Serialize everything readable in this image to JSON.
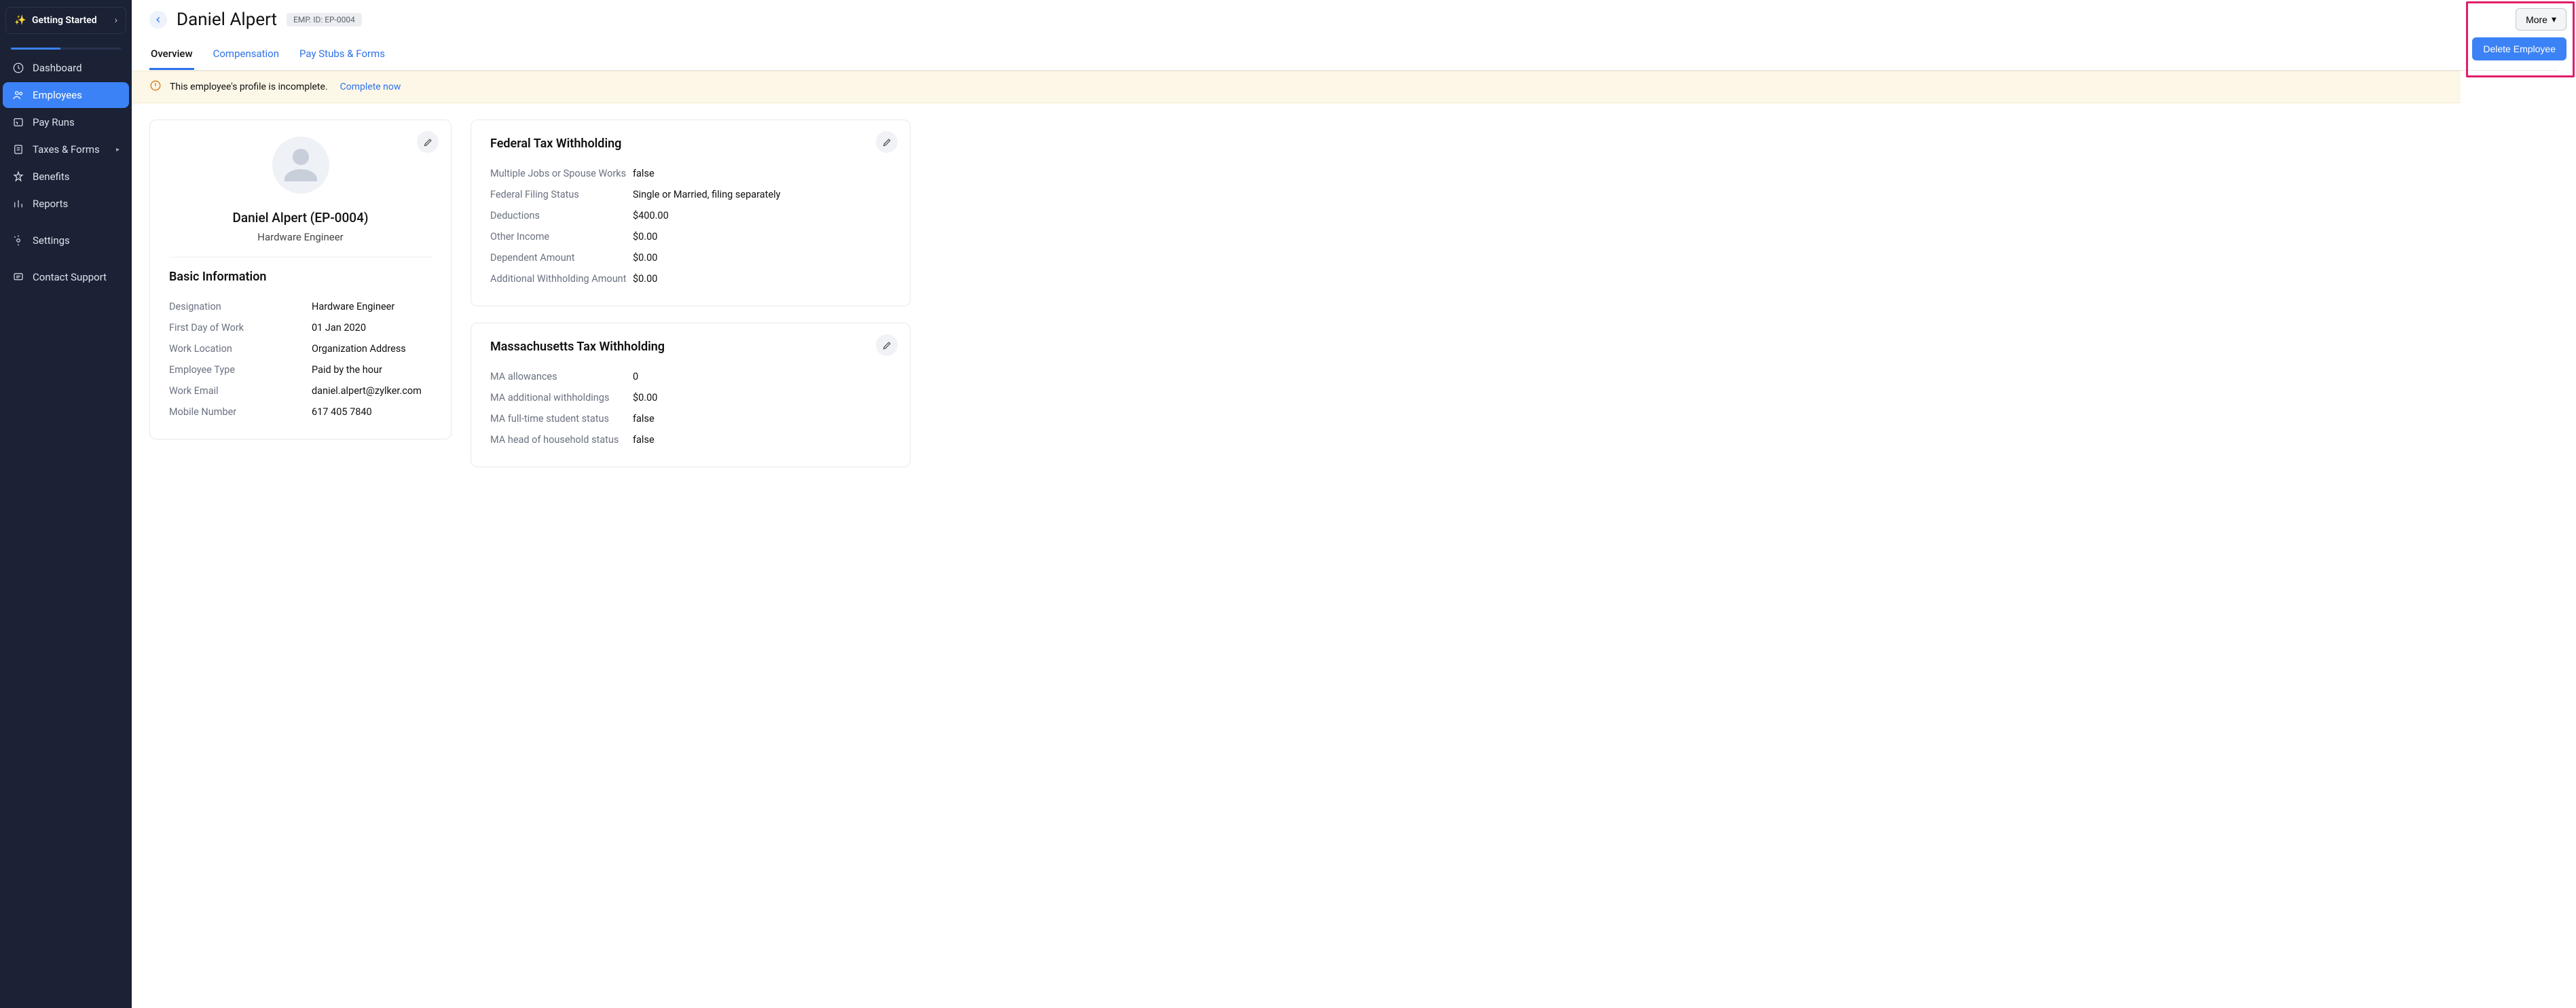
{
  "sidebar": {
    "getting_started": "Getting Started",
    "items": [
      {
        "label": "Dashboard"
      },
      {
        "label": "Employees"
      },
      {
        "label": "Pay Runs"
      },
      {
        "label": "Taxes & Forms"
      },
      {
        "label": "Benefits"
      },
      {
        "label": "Reports"
      },
      {
        "label": "Settings"
      },
      {
        "label": "Contact Support"
      }
    ]
  },
  "header": {
    "employee_name": "Daniel Alpert",
    "emp_id_label": "EMP. ID: EP-0004",
    "more_label": "More",
    "delete_label": "Delete Employee"
  },
  "tabs": [
    {
      "label": "Overview"
    },
    {
      "label": "Compensation"
    },
    {
      "label": "Pay Stubs & Forms"
    }
  ],
  "alert": {
    "message": "This employee's profile is incomplete.",
    "link": "Complete now"
  },
  "profile": {
    "name_line": "Daniel Alpert (EP-0004)",
    "role": "Hardware Engineer"
  },
  "basic_info": {
    "title": "Basic Information",
    "rows": [
      {
        "key": "Designation",
        "val": "Hardware Engineer"
      },
      {
        "key": "First Day of Work",
        "val": "01 Jan 2020"
      },
      {
        "key": "Work Location",
        "val": "Organization Address"
      },
      {
        "key": "Employee Type",
        "val": "Paid by the hour"
      },
      {
        "key": "Work Email",
        "val": "daniel.alpert@zylker.com"
      },
      {
        "key": "Mobile Number",
        "val": "617 405 7840"
      }
    ]
  },
  "federal": {
    "title": "Federal Tax Withholding",
    "rows": [
      {
        "key": "Multiple Jobs or Spouse Works",
        "val": "false"
      },
      {
        "key": "Federal Filing Status",
        "val": "Single or Married, filing separately"
      },
      {
        "key": "Deductions",
        "val": "$400.00"
      },
      {
        "key": "Other Income",
        "val": "$0.00"
      },
      {
        "key": "Dependent Amount",
        "val": "$0.00"
      },
      {
        "key": "Additional Withholding Amount",
        "val": "$0.00"
      }
    ]
  },
  "state": {
    "title": "Massachusetts Tax Withholding",
    "rows": [
      {
        "key": "MA allowances",
        "val": "0"
      },
      {
        "key": "MA additional withholdings",
        "val": "$0.00"
      },
      {
        "key": "MA full-time student status",
        "val": "false"
      },
      {
        "key": "MA head of household status",
        "val": "false"
      }
    ]
  }
}
